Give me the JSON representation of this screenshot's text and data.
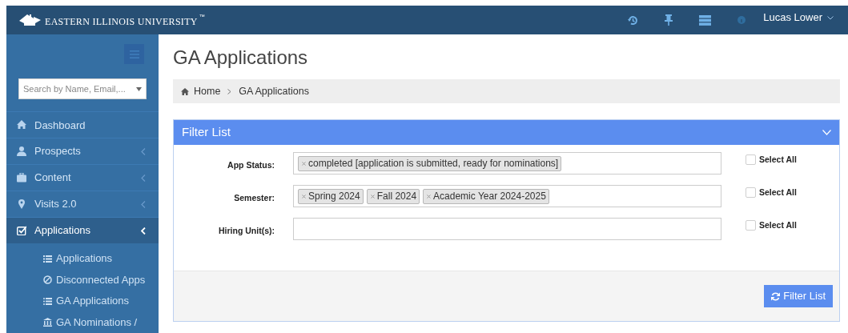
{
  "topbar": {
    "logo_text": "EASTERN ILLINOIS UNIVERSITY",
    "trademark": "™",
    "user": "Lucas Lower"
  },
  "sidebar": {
    "search": {
      "placeholder": "Search by Name, Email,..."
    },
    "items": [
      {
        "label": "Dashboard",
        "selected": false
      },
      {
        "label": "Prospects",
        "selected": false,
        "expanded": false
      },
      {
        "label": "Content",
        "selected": false,
        "expanded": false
      },
      {
        "label": "Visits 2.0",
        "selected": false,
        "expanded": false
      },
      {
        "label": "Applications",
        "selected": true,
        "expanded": true,
        "children": [
          {
            "label": "Applications"
          },
          {
            "label": "Disconnected Apps"
          },
          {
            "label": "GA Applications"
          },
          {
            "label": "GA Nominations /"
          }
        ]
      }
    ]
  },
  "page": {
    "title": "GA Applications",
    "breadcrumb": [
      "Home",
      "GA Applications"
    ]
  },
  "filter_panel": {
    "title": "Filter List",
    "expanded": true,
    "fields": [
      {
        "label": "App Status:",
        "tags": [
          "completed [application is submitted, ready for nominations]"
        ],
        "select_all": {
          "label": "Select All",
          "checked": false
        }
      },
      {
        "label": "Semester:",
        "tags": [
          "Spring 2024",
          "Fall 2024",
          "Academic Year 2024-2025"
        ],
        "select_all": {
          "label": "Select All",
          "checked": false
        }
      },
      {
        "label": "Hiring Unit(s):",
        "select_all": {
          "label": "Select All",
          "checked": false
        }
      }
    ],
    "button": "Filter List"
  }
}
